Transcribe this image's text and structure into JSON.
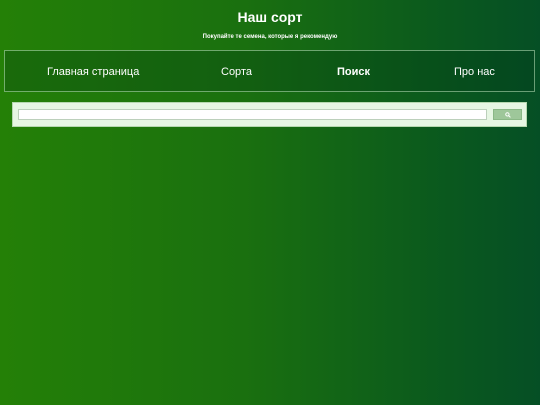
{
  "header": {
    "title": "Наш сорт",
    "subtitle": "Покупайте те семена, которые я рекомендую"
  },
  "nav": {
    "items": [
      {
        "label": "Главная страница",
        "active": false
      },
      {
        "label": "Сорта",
        "active": false
      },
      {
        "label": "Поиск",
        "active": true
      },
      {
        "label": "Про нас",
        "active": false
      }
    ]
  },
  "search": {
    "value": "",
    "placeholder": "",
    "button_icon": "search-icon"
  },
  "colors": {
    "background_left": "#248007",
    "background_right": "#054f25",
    "search_panel": "#e6f6e3",
    "search_button": "#9ec79a"
  }
}
